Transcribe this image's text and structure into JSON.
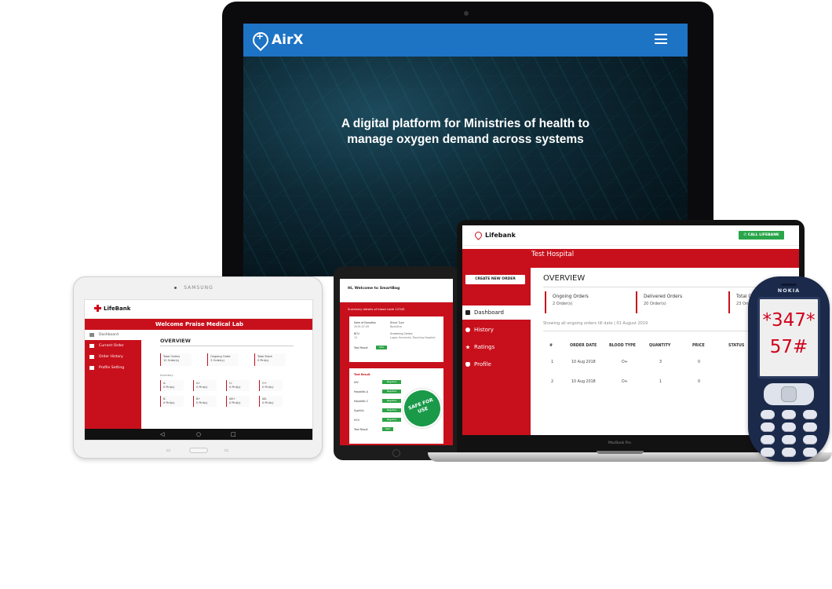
{
  "monitor": {
    "brand": "AirX",
    "tagline_line1": "A digital platform for Ministries of health to",
    "tagline_line2": "manage oxygen demand across systems",
    "accent": "#1d73c4"
  },
  "tablet": {
    "device_brand": "SAMSUNG",
    "app_logo": "LifeBank",
    "banner": "Welcome Praise Medical Lab",
    "sidebar": [
      {
        "label": "Dashboard"
      },
      {
        "label": "Current Order"
      },
      {
        "label": "Order History"
      },
      {
        "label": "Profile Setting"
      }
    ],
    "overview_title": "OVERVIEW",
    "cards": [
      {
        "label": "Total Orders",
        "value": "12 Order(s)"
      },
      {
        "label": "Ongoing Order",
        "value": "3 Order(s)"
      },
      {
        "label": "Total Stock",
        "value": "0 Pint(s)"
      }
    ],
    "summary_label": "Inventory",
    "blood_groups": [
      {
        "type": "A-",
        "value": "0 Pint(s)"
      },
      {
        "type": "A+",
        "value": "0 Pint(s)"
      },
      {
        "type": "O-",
        "value": "0 Pint(s)"
      },
      {
        "type": "O+",
        "value": "0 Pint(s)"
      },
      {
        "type": "B-",
        "value": "0 Pint(s)"
      },
      {
        "type": "B+",
        "value": "0 Pint(s)"
      },
      {
        "type": "AB+",
        "value": "0 Pint(s)"
      },
      {
        "type": "AB-",
        "value": "0 Pint(s)"
      }
    ]
  },
  "smartbag": {
    "welcome": "Hi, Welcome to SmartBag",
    "summary": "Summary details of blood code 12345",
    "details": [
      {
        "label": "Date of Donation",
        "value": "2019-07-09"
      },
      {
        "label": "Blood Type",
        "value": "Bpositive"
      },
      {
        "label": "BCU",
        "value": "12"
      },
      {
        "label": "Screening Centre",
        "value": "Lagos University Teaching Hospital"
      },
      {
        "label": "Test Result",
        "value": "Safe"
      }
    ],
    "test_result_title": "Test Result",
    "tests": [
      {
        "label": "HIV",
        "value": "Negative"
      },
      {
        "label": "Hepatitis A",
        "value": "Negative"
      },
      {
        "label": "Hepatitis C",
        "value": "Negative"
      },
      {
        "label": "Syphilis",
        "value": "Negative"
      },
      {
        "label": "HCV",
        "value": "Negative"
      },
      {
        "label": "Test Result",
        "value": "Safe"
      }
    ],
    "stamp": "SAFE FOR USE"
  },
  "laptop": {
    "app_logo": "Lifebank",
    "call_button": "CALL LIFEBANK",
    "hospital": "Test Hospital",
    "create_button": "CREATE NEW ORDER",
    "nav": [
      {
        "label": "Dashboard"
      },
      {
        "label": "History"
      },
      {
        "label": "Ratings"
      },
      {
        "label": "Profile"
      }
    ],
    "overview_title": "OVERVIEW",
    "cards": [
      {
        "label": "Ongoing Orders",
        "value": "2 Order(s)"
      },
      {
        "label": "Delivered Orders",
        "value": "20 Order(s)"
      },
      {
        "label": "Total Orders",
        "value": "23 Order(s)"
      }
    ],
    "showing_text": "Showing all ongoing orders till date | 01 August 2019",
    "table": {
      "headers": [
        "#",
        "ORDER DATE",
        "BLOOD TYPE",
        "QUANTITY",
        "PRICE",
        "STATUS"
      ],
      "rows": [
        [
          "1",
          "10 Aug 2018",
          "O+",
          "3",
          "0",
          ""
        ],
        [
          "2",
          "10 Aug 2018",
          "O+",
          "1",
          "0",
          ""
        ]
      ]
    },
    "device_label": "MacBook Pro",
    "accent": "#c8101c",
    "call_color": "#2aa64a"
  },
  "phone": {
    "brand": "NOKIA",
    "code_line1": "*347*",
    "code_line2": "57#"
  }
}
